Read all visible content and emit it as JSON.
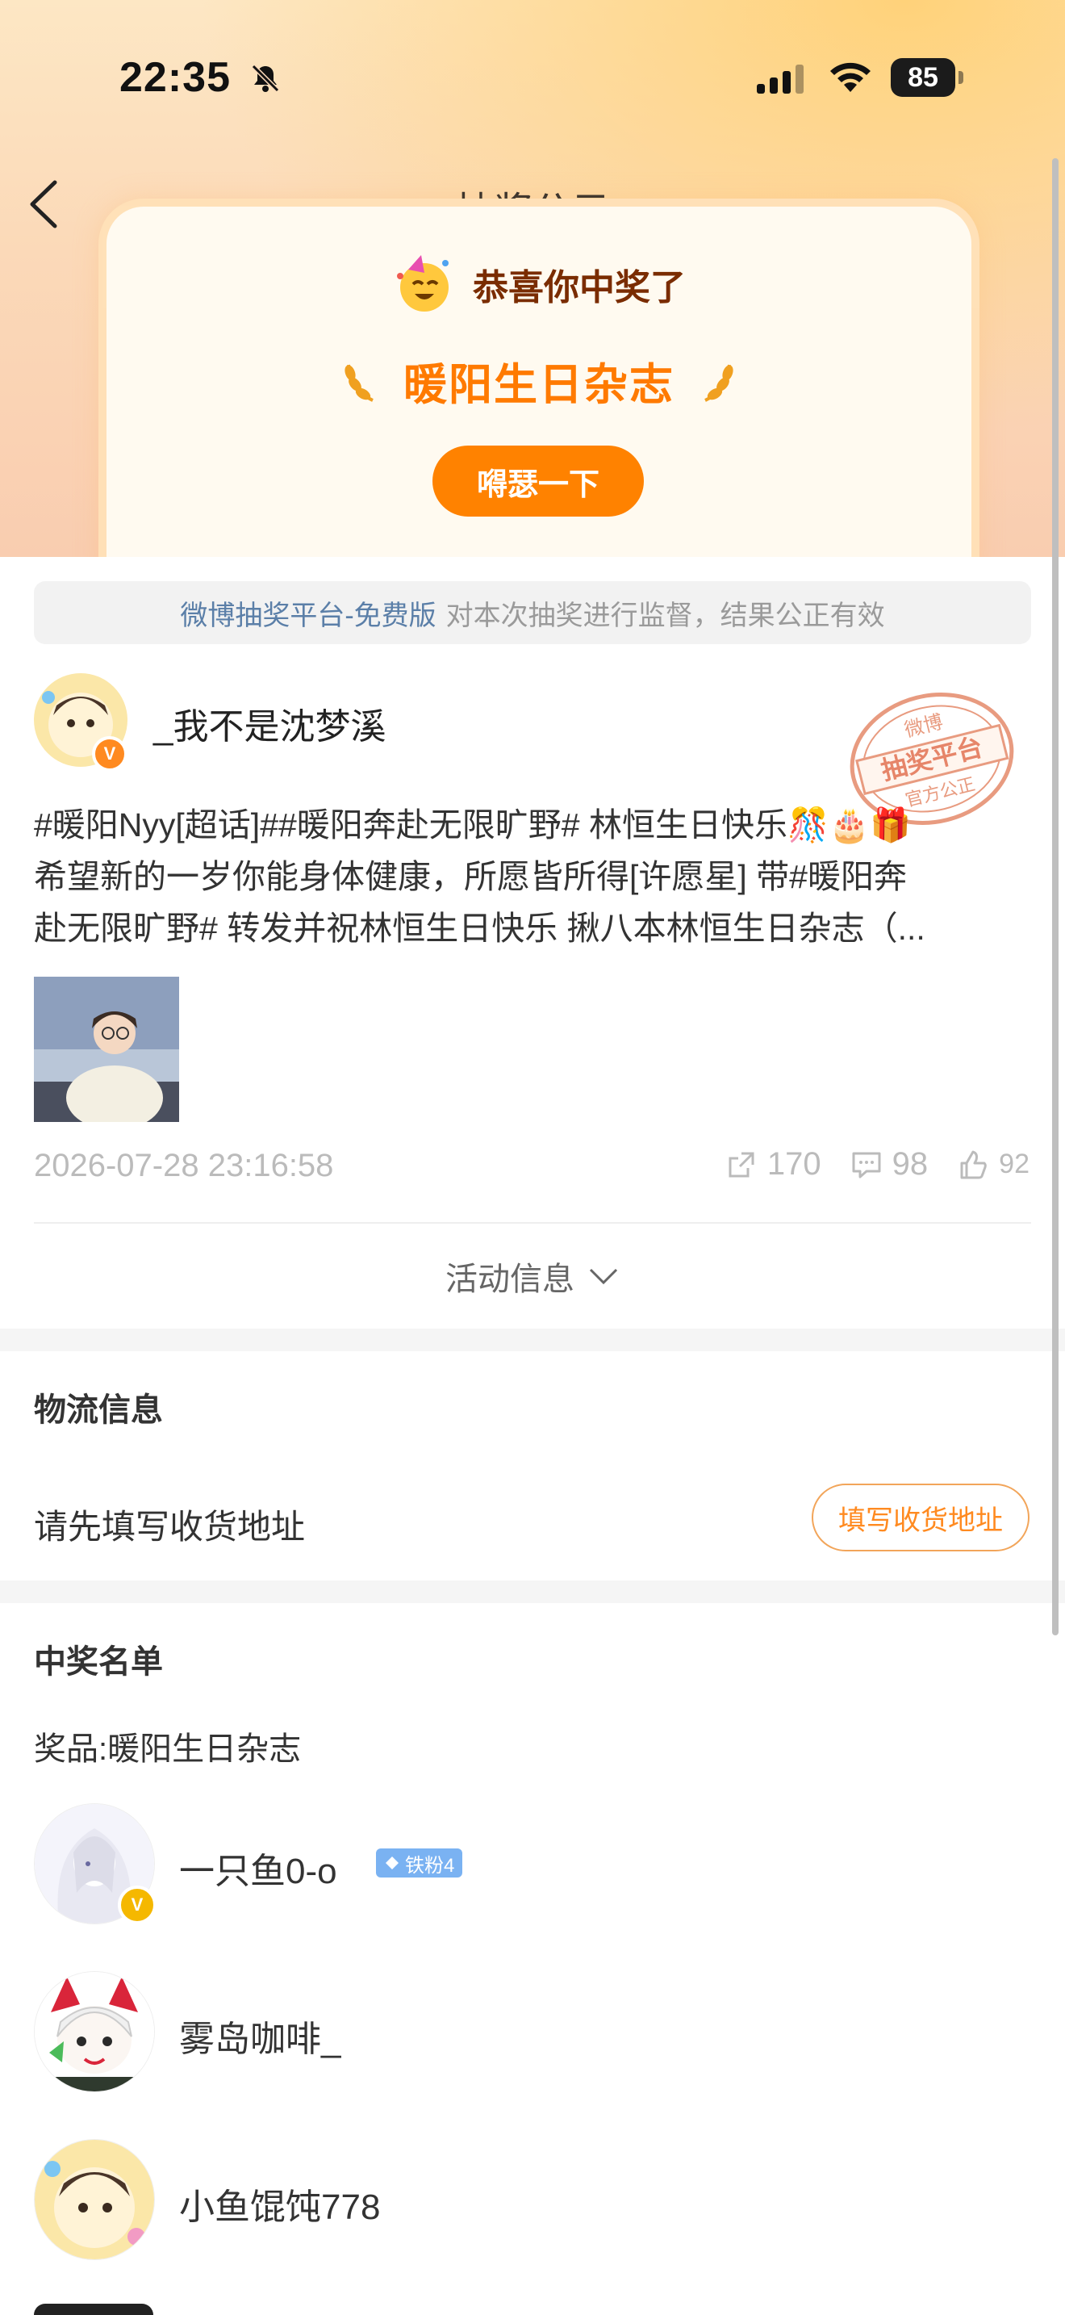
{
  "status_bar": {
    "time": "22:35",
    "battery": "85"
  },
  "header": {
    "title": "抽奖公示"
  },
  "hero": {
    "congrats": "恭喜你中奖了",
    "prize_name": "暖阳生日杂志",
    "celebrate_button": "嘚瑟一下"
  },
  "notice": {
    "link_text": "微博抽奖平台-免费版",
    "text": "对本次抽奖进行监督，结果公正有效"
  },
  "post": {
    "author": "_我不是沈梦溪",
    "stamp": {
      "top": "微博",
      "middle": "抽奖平台",
      "bottom": "官方公正"
    },
    "lines": [
      "#暖阳Nyy[超话]##暖阳奔赴无限旷野# 林恒生日快乐🎊🎂🎁",
      "希望新的一岁你能身体健康，所愿皆所得[许愿星] 带#暖阳奔",
      "赴无限旷野# 转发并祝林恒生日快乐 揪八本林恒生日杂志（..."
    ],
    "timestamp": "2026-07-28 23:16:58",
    "reposts": "170",
    "comments": "98",
    "likes": "92",
    "activity_label": "活动信息"
  },
  "logistics": {
    "title": "物流信息",
    "prompt": "请先填写收货地址",
    "button": "填写收货地址"
  },
  "winners": {
    "title": "中奖名单",
    "prize_label": "奖品:暖阳生日杂志",
    "list": [
      {
        "name": "一只鱼0-o",
        "badge": "铁粉4"
      },
      {
        "name": "雾岛咖啡_"
      },
      {
        "name": "小鱼馄饨778"
      }
    ]
  }
}
